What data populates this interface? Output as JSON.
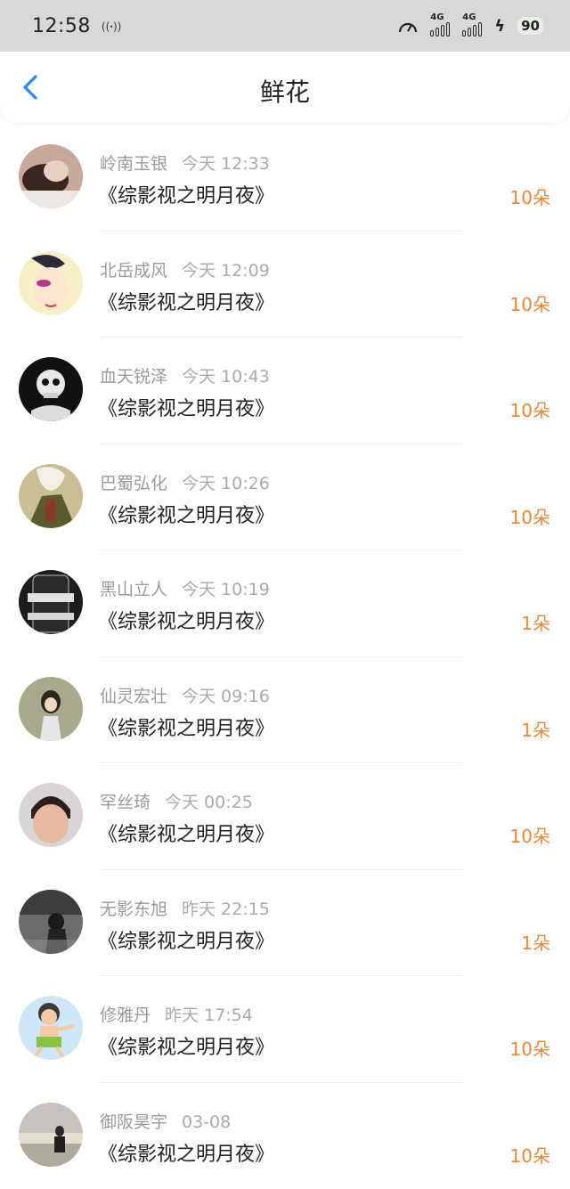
{
  "status_bar": {
    "time": "12:58",
    "nfc_icon": "nfc-icon",
    "sim1_label": "4G",
    "sim2_label": "4G",
    "battery": "90"
  },
  "nav": {
    "back_icon": "chevron-left-icon",
    "title": "鲜花"
  },
  "colors": {
    "accent": "#2a8bf2",
    "count": "#e8883a",
    "meta": "#9a9a9a",
    "status_bar_bg": "#d8d8d8"
  },
  "records": [
    {
      "user": "岭南玉银",
      "time": "今天 12:33",
      "book": "《综影视之明月夜》",
      "count": "10朵"
    },
    {
      "user": "北岳成风",
      "time": "今天 12:09",
      "book": "《综影视之明月夜》",
      "count": "10朵"
    },
    {
      "user": "血天锐泽",
      "time": "今天 10:43",
      "book": "《综影视之明月夜》",
      "count": "10朵"
    },
    {
      "user": "巴蜀弘化",
      "time": "今天 10:26",
      "book": "《综影视之明月夜》",
      "count": "10朵"
    },
    {
      "user": "黑山立人",
      "time": "今天 10:19",
      "book": "《综影视之明月夜》",
      "count": "1朵"
    },
    {
      "user": "仙灵宏壮",
      "time": "今天 09:16",
      "book": "《综影视之明月夜》",
      "count": "1朵"
    },
    {
      "user": "罕丝琦",
      "time": "今天 00:25",
      "book": "《综影视之明月夜》",
      "count": "10朵"
    },
    {
      "user": "无影东旭",
      "time": "昨天 22:15",
      "book": "《综影视之明月夜》",
      "count": "1朵"
    },
    {
      "user": "修雅丹",
      "time": "昨天 17:54",
      "book": "《综影视之明月夜》",
      "count": "10朵"
    },
    {
      "user": "御阪昊宇",
      "time": "03-08",
      "book": "《综影视之明月夜》",
      "count": "10朵"
    }
  ]
}
